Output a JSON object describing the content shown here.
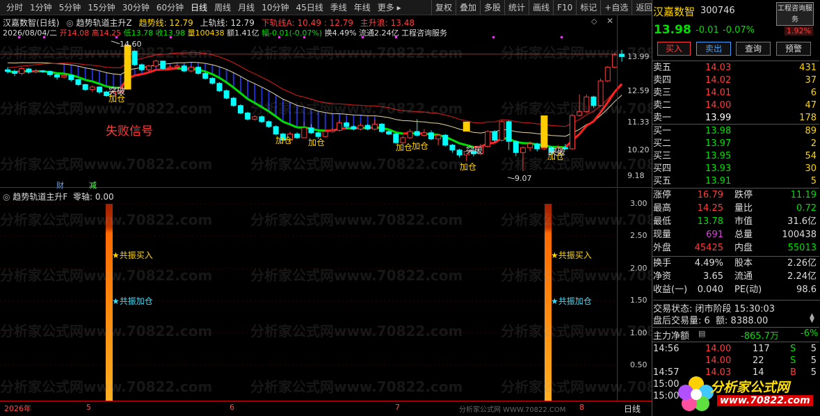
{
  "toolbar": {
    "periods": [
      "分时",
      "1分钟",
      "5分钟",
      "15分钟",
      "30分钟",
      "60分钟",
      "日线",
      "周线",
      "月线",
      "10分钟",
      "45日线",
      "季线",
      "年线",
      "更多 ▸"
    ],
    "tools": [
      "复权",
      "叠加",
      "多股",
      "统计",
      "画线",
      "F10",
      "标记",
      "+自选",
      "返回"
    ]
  },
  "chart": {
    "title": "汉嘉数智(日线)",
    "indicator_name": "趋势轨道主升Z",
    "trend_line": "趋势线: 12.79",
    "upper_line": "上轨线: 12.79",
    "lower_line_a": "下轨线A: 10.49 : 12.79",
    "main_rise": "主升浪: 13.48",
    "info": {
      "date": "2026/08/04/二",
      "open": "开14.08",
      "high": "高14.25",
      "low": "低13.78",
      "close": "收13.98",
      "volume": "量100438",
      "amount": "额1.41亿",
      "change": "幅-0.01(-0.07%)",
      "turnover": "换4.49%",
      "float_cap": "流通2.24亿",
      "concept": "工程咨询服务"
    },
    "y_ticks": [
      "13.99",
      "12.59",
      "11.33",
      "10.20",
      "9.18"
    ],
    "annotations": {
      "high_mark": "14.60",
      "low_mark": "9.07",
      "fail": "失败信号",
      "break": "突破",
      "add": "加仓"
    },
    "markers": [
      "财",
      "减"
    ]
  },
  "chart_data": {
    "type": "candlestick",
    "candles": [
      [
        13.45,
        13.38,
        13.55,
        13.3
      ],
      [
        13.38,
        13.3,
        13.45,
        13.2
      ],
      [
        13.3,
        13.5,
        13.56,
        13.22
      ],
      [
        13.48,
        13.35,
        13.52,
        13.28
      ],
      [
        13.36,
        13.4,
        13.48,
        13.3
      ],
      [
        13.4,
        13.38,
        13.44,
        13.32
      ],
      [
        13.38,
        13.25,
        13.42,
        13.18
      ],
      [
        13.25,
        13.15,
        13.3,
        13.05
      ],
      [
        13.15,
        13.22,
        13.28,
        13.1
      ],
      [
        13.22,
        13.05,
        13.25,
        12.98
      ],
      [
        13.05,
        12.85,
        13.08,
        12.8
      ],
      [
        12.85,
        12.65,
        12.88,
        12.6
      ],
      [
        12.65,
        12.75,
        12.82,
        12.55
      ],
      [
        12.75,
        12.55,
        12.78,
        12.48
      ],
      [
        12.55,
        12.4,
        12.6,
        12.35
      ],
      [
        12.4,
        12.55,
        12.62,
        12.38
      ],
      [
        12.55,
        12.7,
        12.75,
        12.5
      ],
      [
        12.7,
        14.4,
        14.6,
        12.65
      ],
      [
        14.2,
        13.65,
        14.25,
        13.6
      ],
      [
        13.65,
        13.45,
        13.7,
        13.4
      ],
      [
        13.45,
        13.6,
        13.65,
        13.4
      ],
      [
        13.6,
        13.8,
        13.85,
        13.55
      ],
      [
        13.8,
        13.5,
        13.82,
        13.45
      ],
      [
        13.5,
        13.55,
        13.62,
        13.48
      ],
      [
        13.55,
        13.6,
        13.66,
        13.5
      ],
      [
        13.6,
        13.4,
        13.65,
        13.35
      ],
      [
        13.4,
        13.55,
        13.6,
        13.35
      ],
      [
        13.55,
        13.3,
        13.58,
        13.25
      ],
      [
        13.3,
        13.1,
        13.35,
        13.05
      ],
      [
        13.1,
        12.9,
        13.15,
        12.85
      ],
      [
        12.9,
        12.6,
        12.95,
        12.55
      ],
      [
        12.6,
        12.3,
        12.65,
        12.25
      ],
      [
        12.3,
        12.0,
        12.35,
        11.95
      ],
      [
        12.0,
        11.7,
        12.05,
        11.65
      ],
      [
        11.7,
        11.45,
        11.75,
        11.4
      ],
      [
        11.45,
        11.55,
        11.62,
        11.4
      ],
      [
        11.55,
        11.35,
        11.6,
        11.3
      ],
      [
        11.35,
        11.15,
        11.4,
        11.1
      ],
      [
        11.15,
        10.85,
        11.2,
        10.8
      ],
      [
        10.85,
        10.6,
        10.9,
        10.55
      ],
      [
        10.6,
        10.85,
        10.95,
        10.5
      ],
      [
        10.85,
        10.7,
        10.92,
        10.65
      ],
      [
        10.7,
        11.1,
        11.35,
        10.68
      ],
      [
        11.1,
        10.9,
        11.25,
        10.85
      ],
      [
        10.9,
        10.75,
        10.95,
        10.65
      ],
      [
        10.75,
        10.95,
        11.0,
        10.7
      ],
      [
        10.95,
        11.0,
        11.1,
        10.9
      ],
      [
        11.0,
        11.3,
        11.4,
        10.95
      ],
      [
        11.3,
        11.15,
        11.35,
        11.05
      ],
      [
        11.15,
        11.05,
        11.2,
        11.0
      ],
      [
        11.05,
        11.2,
        11.28,
        11.0
      ],
      [
        11.2,
        11.05,
        11.25,
        11.0
      ],
      [
        11.05,
        11.25,
        11.45,
        11.0
      ],
      [
        11.25,
        10.95,
        11.3,
        10.9
      ],
      [
        10.95,
        10.85,
        11.0,
        10.8
      ],
      [
        10.85,
        10.5,
        10.9,
        10.45
      ],
      [
        10.5,
        10.7,
        10.78,
        10.45
      ],
      [
        10.7,
        10.95,
        11.05,
        10.65
      ],
      [
        10.95,
        10.8,
        11.45,
        10.75
      ],
      [
        10.8,
        10.9,
        11.05,
        10.75
      ],
      [
        10.9,
        10.65,
        11.0,
        10.6
      ],
      [
        10.65,
        10.8,
        10.85,
        10.4
      ],
      [
        10.8,
        10.4,
        10.85,
        10.35
      ],
      [
        10.4,
        10.2,
        10.45,
        10.1
      ],
      [
        10.2,
        10.0,
        10.25,
        9.9
      ],
      [
        10.0,
        10.15,
        10.2,
        9.75
      ],
      [
        10.15,
        10.05,
        10.3,
        9.95
      ],
      [
        10.05,
        10.35,
        10.45,
        10.0
      ],
      [
        10.35,
        10.95,
        11.0,
        10.3
      ],
      [
        10.95,
        10.6,
        11.0,
        10.5
      ],
      [
        10.6,
        11.35,
        11.4,
        10.55
      ],
      [
        11.35,
        10.55,
        11.4,
        10.2
      ],
      [
        10.55,
        10.1,
        10.6,
        9.95
      ],
      [
        10.1,
        10.3,
        10.35,
        9.35
      ],
      [
        10.3,
        10.45,
        10.55,
        10.15
      ],
      [
        10.45,
        10.25,
        10.5,
        10.15
      ],
      [
        10.25,
        10.3,
        10.4,
        10.2
      ],
      [
        10.3,
        10.1,
        10.35,
        10.05
      ],
      [
        10.1,
        10.3,
        10.4,
        10.05
      ],
      [
        10.3,
        10.25,
        10.45,
        10.2
      ],
      [
        10.25,
        11.6,
        11.65,
        10.22
      ],
      [
        11.6,
        11.75,
        12.45,
        11.55
      ],
      [
        11.75,
        12.35,
        12.45,
        11.7
      ],
      [
        12.35,
        12.0,
        12.4,
        11.9
      ],
      [
        12.0,
        13.0,
        13.1,
        11.95
      ],
      [
        13.0,
        13.55,
        13.6,
        12.95
      ],
      [
        13.55,
        14.05,
        14.15,
        13.5
      ],
      [
        14.08,
        13.98,
        14.25,
        13.78
      ]
    ],
    "y_ticks": [
      13.99,
      12.59,
      11.33,
      10.2,
      9.18
    ],
    "x_ticks": [
      "2026年",
      "5",
      "6",
      "7",
      "8"
    ],
    "indicator": {
      "name": "趋势轨道主升F",
      "zero_axis": "零轴: 0.00",
      "y_ticks": [
        "3.00",
        "2.50",
        "2.00",
        "1.50",
        "1.00",
        "0.50"
      ],
      "labels": [
        "★共振买入",
        "★共振加仓"
      ]
    }
  },
  "side": {
    "name": "汉嘉数智",
    "code": "300746",
    "badge": "工程咨询服务",
    "price": "13.98",
    "chg": "-0.01",
    "pct": "-0.07%",
    "amp": "1.92%",
    "buttons": [
      "买入",
      "卖出",
      "查询",
      "预警"
    ],
    "asks": [
      [
        "卖五",
        "14.03",
        "431"
      ],
      [
        "卖四",
        "14.02",
        "37"
      ],
      [
        "卖三",
        "14.01",
        "6"
      ],
      [
        "卖二",
        "14.00",
        "47"
      ],
      [
        "卖一",
        "13.99",
        "178"
      ]
    ],
    "bids": [
      [
        "买一",
        "13.98",
        "89"
      ],
      [
        "买二",
        "13.97",
        "2"
      ],
      [
        "买三",
        "13.95",
        "54"
      ],
      [
        "买四",
        "13.93",
        "30"
      ],
      [
        "买五",
        "13.91",
        "5"
      ]
    ],
    "stats": [
      [
        "涨停",
        "16.79",
        "跌停",
        "11.19"
      ],
      [
        "最高",
        "14.25",
        "量比",
        "0.72"
      ],
      [
        "最低",
        "13.78",
        "市值",
        "31.6亿"
      ],
      [
        "现量",
        "691",
        "总量",
        "100438"
      ],
      [
        "外盘",
        "45425",
        "内盘",
        "55013"
      ]
    ],
    "stats2": [
      [
        "换手",
        "4.49%",
        "股本",
        "2.26亿"
      ],
      [
        "净资",
        "3.65",
        "流通",
        "2.24亿"
      ],
      [
        "收益(一)",
        "0.040",
        "PE(动)",
        "98.6"
      ]
    ],
    "trade_state": "交易状态: 闭市阶段 15:30:03",
    "after_vol": "盘后交易量: 6  额: 8388.00",
    "main_net": "主力净额",
    "main_net_val": "-865.7万",
    "main_net_pct": "-6%",
    "ticks": [
      [
        "14:56",
        "14.00",
        "117",
        "S",
        "5"
      ],
      [
        "",
        "14.00",
        "22",
        "S",
        "5"
      ],
      [
        "14:57",
        "14.03",
        "14",
        "B",
        "5"
      ],
      [
        "15:00",
        ""
      ],
      [
        "15:00",
        ""
      ]
    ]
  },
  "footer": {
    "period": "日线",
    "link": "分析家公式网 WWW.70822.COM"
  },
  "watermark": {
    "text": "分析家公式网www.70822.com",
    "logo": "分析家公式网",
    "url": "www.70822.com"
  },
  "colors": {
    "up": "#ff3c3c",
    "down": "#00ffff",
    "ma": "#e8c040",
    "trend_green": "#00e000",
    "trend_red": "#ff2020"
  }
}
